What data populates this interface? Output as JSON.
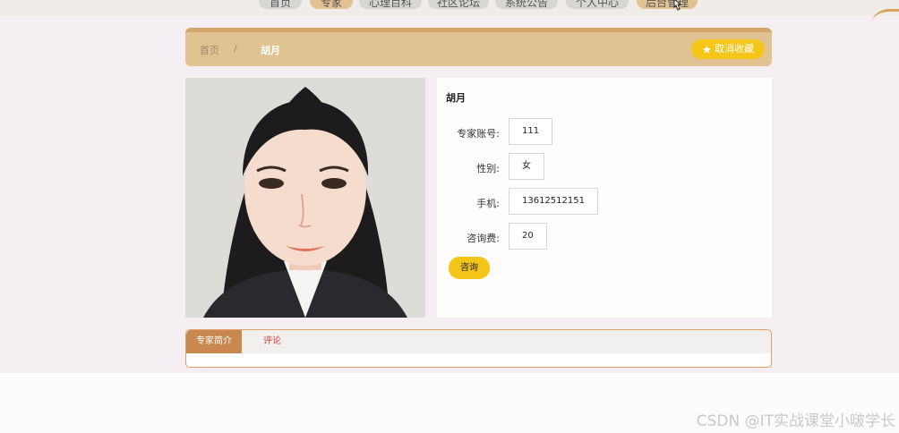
{
  "nav": {
    "items": [
      "首页",
      "专家",
      "心理百科",
      "社区论坛",
      "系统公告",
      "个人中心",
      "后台管理"
    ]
  },
  "breadcrumb": {
    "home": "首页",
    "separator": "/",
    "current": "胡月"
  },
  "favorite_button": "取消收藏",
  "expert": {
    "name": "胡月",
    "fields": [
      {
        "label": "专家账号:",
        "value": "111"
      },
      {
        "label": "性别:",
        "value": "女"
      },
      {
        "label": "手机:",
        "value": "13612512151"
      },
      {
        "label": "咨询费:",
        "value": "20"
      }
    ],
    "consult_button": "咨询"
  },
  "tabs": {
    "intro": "专家简介",
    "comments": "评论"
  },
  "watermark": "CSDN @IT实战课堂小啵学长",
  "colors": {
    "accent_gold": "#e1c391",
    "button_yellow": "#f5c518",
    "tab_active": "#c9884e",
    "comment_red": "#e04040"
  }
}
